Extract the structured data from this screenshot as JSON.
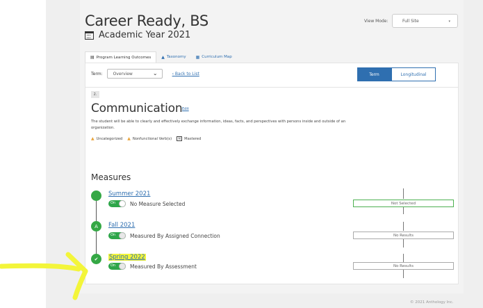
{
  "header": {
    "title": "Career Ready, BS",
    "academic_year": "Academic Year 2021",
    "view_mode_label": "View Mode:",
    "view_mode_value": "Full Site"
  },
  "tabs": [
    {
      "label": "Program Learning Outcomes",
      "icon": "list-icon",
      "active": true
    },
    {
      "label": "Taxonomy",
      "icon": "triangle-icon",
      "active": false
    },
    {
      "label": "Curriculum Map",
      "icon": "grid-icon",
      "active": false
    }
  ],
  "toolbar": {
    "term_label": "Term:",
    "term_value": "Overview",
    "back_label": "Back to List",
    "view_toggle": {
      "term": "Term",
      "longitudinal": "Longitudinal"
    }
  },
  "outcome": {
    "number": "2.",
    "title": "Communication",
    "edit_label": "Edit",
    "description": "The student will be able to clearly and effectively exchange information, ideas, facts, and perspectives with persons inside and outside of an organization.",
    "legend": {
      "uncategorized": "Uncategorized",
      "nonfunctional": "Nonfunctional Verb(s)",
      "mastered": "Mastered"
    }
  },
  "measures": {
    "title": "Measures",
    "items": [
      {
        "term": "Summer 2021",
        "node": "",
        "toggle": "On",
        "text": "No Measure Selected",
        "status": "Not Selected",
        "highlighted": false
      },
      {
        "term": "Fall 2021",
        "node": "A",
        "toggle": "On",
        "text": "Measured By Assigned Connection",
        "status": "No Results",
        "highlighted": false
      },
      {
        "term": "Spring 2022",
        "node": "✔",
        "toggle": "On",
        "text": "Measured By Assessment",
        "status": "No Results",
        "highlighted": true
      }
    ]
  },
  "footer": {
    "copyright": "© 2021 Anthology Inc."
  },
  "colors": {
    "accent": "#2f6fb0",
    "node_green": "#35a845",
    "highlight": "#f3f53a"
  }
}
